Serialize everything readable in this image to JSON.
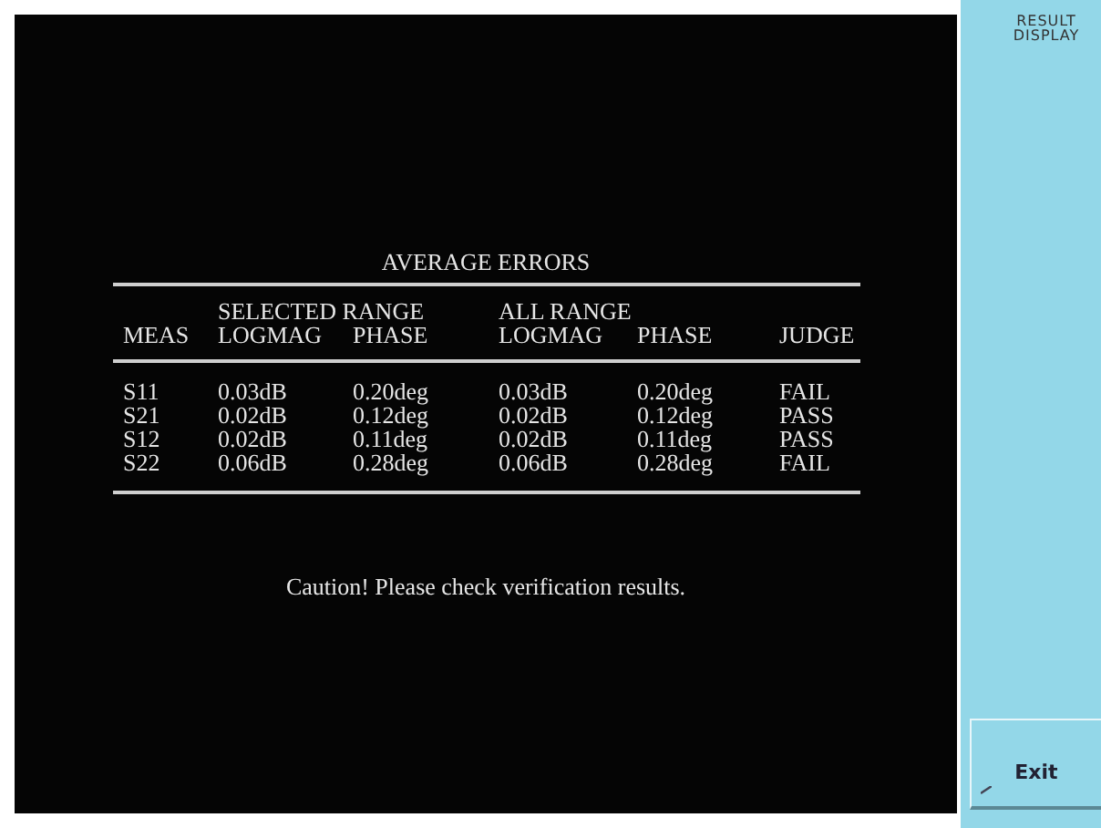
{
  "panel_title": "AVERAGE ERRORS",
  "groups": [
    "SELECTED RANGE",
    "ALL RANGE"
  ],
  "columns": [
    "MEAS",
    "LOGMAG",
    "PHASE",
    "LOGMAG",
    "PHASE",
    "JUDGE"
  ],
  "rows": [
    [
      "S11",
      "0.03dB",
      "0.20deg",
      "0.03dB",
      "0.20deg",
      "FAIL"
    ],
    [
      "S21",
      "0.02dB",
      "0.12deg",
      "0.02dB",
      "0.12deg",
      "PASS"
    ],
    [
      "S12",
      "0.02dB",
      "0.11deg",
      "0.02dB",
      "0.11deg",
      "PASS"
    ],
    [
      "S22",
      "0.06dB",
      "0.28deg",
      "0.06dB",
      "0.28deg",
      "FAIL"
    ]
  ],
  "message": "Caution! Please check verification results.",
  "softkey_menu": {
    "title": "RESULT DISPLAY",
    "buttons": [
      "Exit"
    ]
  }
}
